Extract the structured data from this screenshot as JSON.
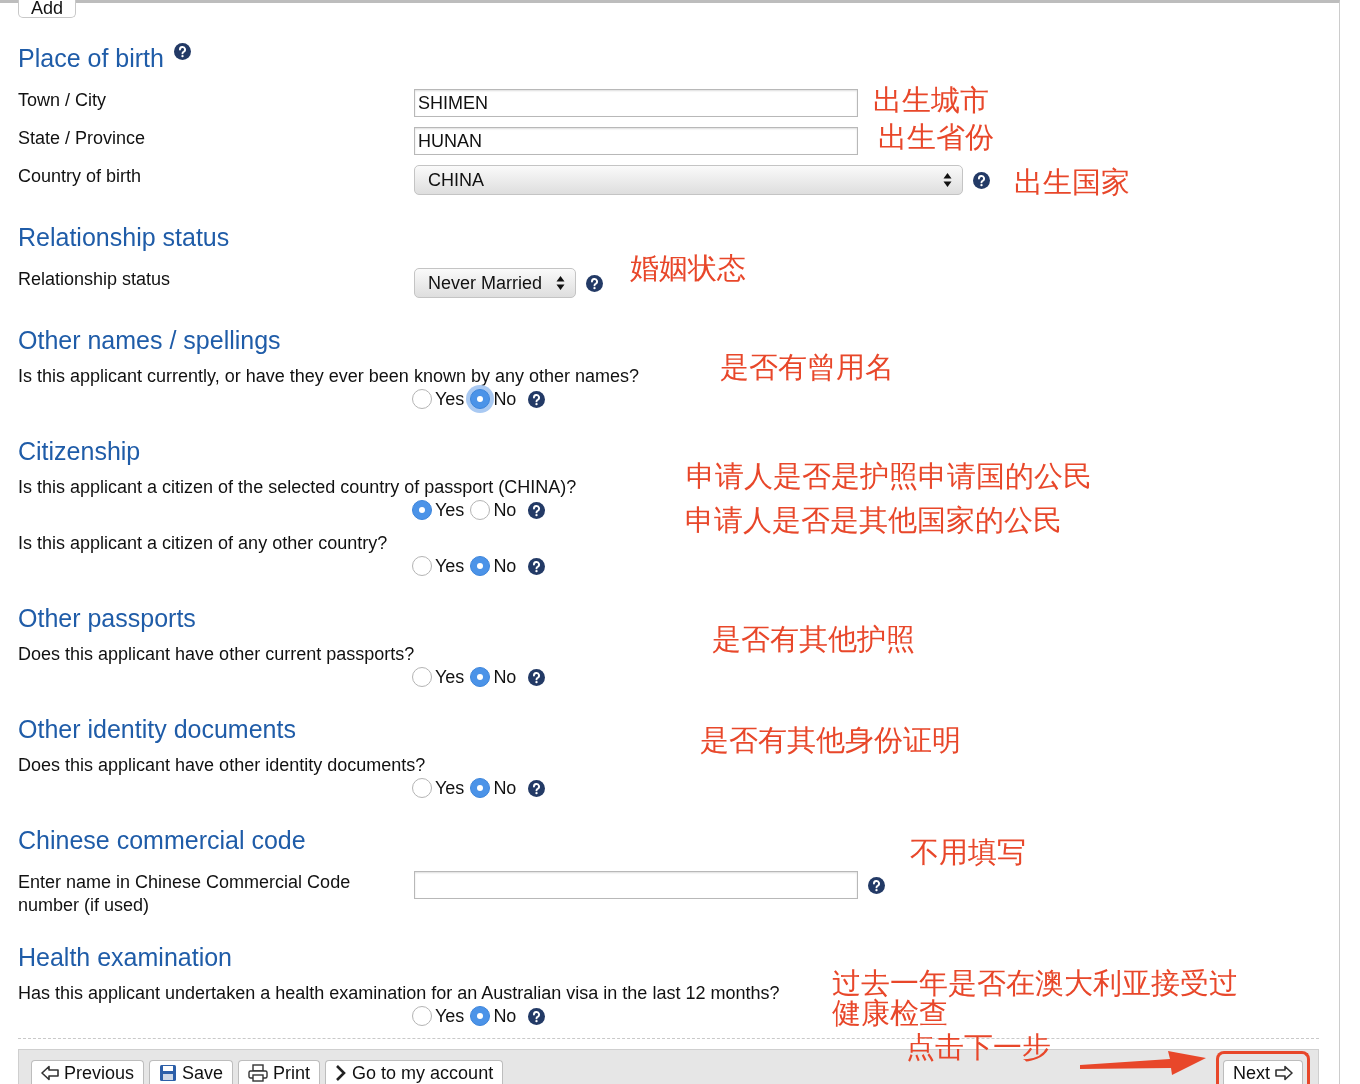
{
  "add_button": "Add",
  "sections": [
    {
      "heading": "Place of birth",
      "help": true,
      "rows": [
        {
          "kind": "text",
          "label": "Town / City",
          "value": "SHIMEN",
          "help": false
        },
        {
          "kind": "text",
          "label": "State / Province",
          "value": "HUNAN",
          "help": false
        },
        {
          "kind": "wide-select",
          "label": "Country of birth",
          "value": "CHINA",
          "help": true
        }
      ]
    },
    {
      "heading": "Relationship status",
      "help": false,
      "rows": [
        {
          "kind": "select",
          "label": "Relationship status",
          "value": "Never Married",
          "help": true
        }
      ]
    },
    {
      "heading": "Other names / spellings",
      "help": false,
      "rows": [
        {
          "kind": "radio",
          "question": "Is this applicant currently, or have they ever been known by any other names?",
          "focused": true,
          "help": true,
          "options": [
            {
              "label": "Yes",
              "selected": false
            },
            {
              "label": "No",
              "selected": true
            }
          ]
        }
      ]
    },
    {
      "heading": "Citizenship",
      "help": false,
      "rows": [
        {
          "kind": "radio",
          "question": "Is this applicant a citizen of the selected country of passport (CHINA)?",
          "focused": false,
          "help": true,
          "options": [
            {
              "label": "Yes",
              "selected": true
            },
            {
              "label": "No",
              "selected": false
            }
          ]
        },
        {
          "kind": "radio",
          "question": "Is this applicant a citizen of any other country?",
          "focused": false,
          "help": true,
          "options": [
            {
              "label": "Yes",
              "selected": false
            },
            {
              "label": "No",
              "selected": true
            }
          ]
        }
      ]
    },
    {
      "heading": "Other passports",
      "help": false,
      "rows": [
        {
          "kind": "radio",
          "question": "Does this applicant have other current passports?",
          "focused": false,
          "help": true,
          "options": [
            {
              "label": "Yes",
              "selected": false
            },
            {
              "label": "No",
              "selected": true
            }
          ]
        }
      ]
    },
    {
      "heading": "Other identity documents",
      "help": false,
      "rows": [
        {
          "kind": "radio",
          "question": "Does this applicant have other identity documents?",
          "focused": false,
          "help": true,
          "options": [
            {
              "label": "Yes",
              "selected": false
            },
            {
              "label": "No",
              "selected": true
            }
          ]
        }
      ]
    },
    {
      "heading": "Chinese commercial code",
      "help": false,
      "rows": [
        {
          "kind": "text",
          "label": "Enter name in Chinese Commercial Code number (if used)",
          "help": true
        }
      ]
    },
    {
      "heading": "Health examination",
      "help": false,
      "rows": [
        {
          "kind": "radio",
          "question": "Has this applicant undertaken a health examination for an Australian visa in the last 12 months?",
          "focused": false,
          "help": true,
          "options": [
            {
              "label": "Yes",
              "selected": false
            },
            {
              "label": "No",
              "selected": true
            }
          ]
        }
      ]
    }
  ],
  "footer": {
    "buttons": [
      {
        "kind": "previous",
        "label": "Previous"
      },
      {
        "kind": "save",
        "label": "Save"
      },
      {
        "kind": "print",
        "label": "Print"
      },
      {
        "kind": "account",
        "label": "Go to my account"
      }
    ],
    "next": {
      "label": "Next",
      "highlighted": true
    }
  },
  "annotations": [
    {
      "text": "出生城市"
    },
    {
      "text": "出生省份"
    },
    {
      "text": "出生国家"
    },
    {
      "text": "婚姻状态"
    },
    {
      "text": "是否有曾用名"
    },
    {
      "text": "申请人是否是护照申请国的公民"
    },
    {
      "text": "申请人是否是其他国家的公民"
    },
    {
      "text": "是否有其他护照"
    },
    {
      "text": "是否有其他身份证明"
    },
    {
      "text": "不用填写"
    },
    {
      "text": "过去一年是否在澳大利亚接受过"
    },
    {
      "text": "健康检查"
    },
    {
      "text": "点击下一步"
    }
  ]
}
